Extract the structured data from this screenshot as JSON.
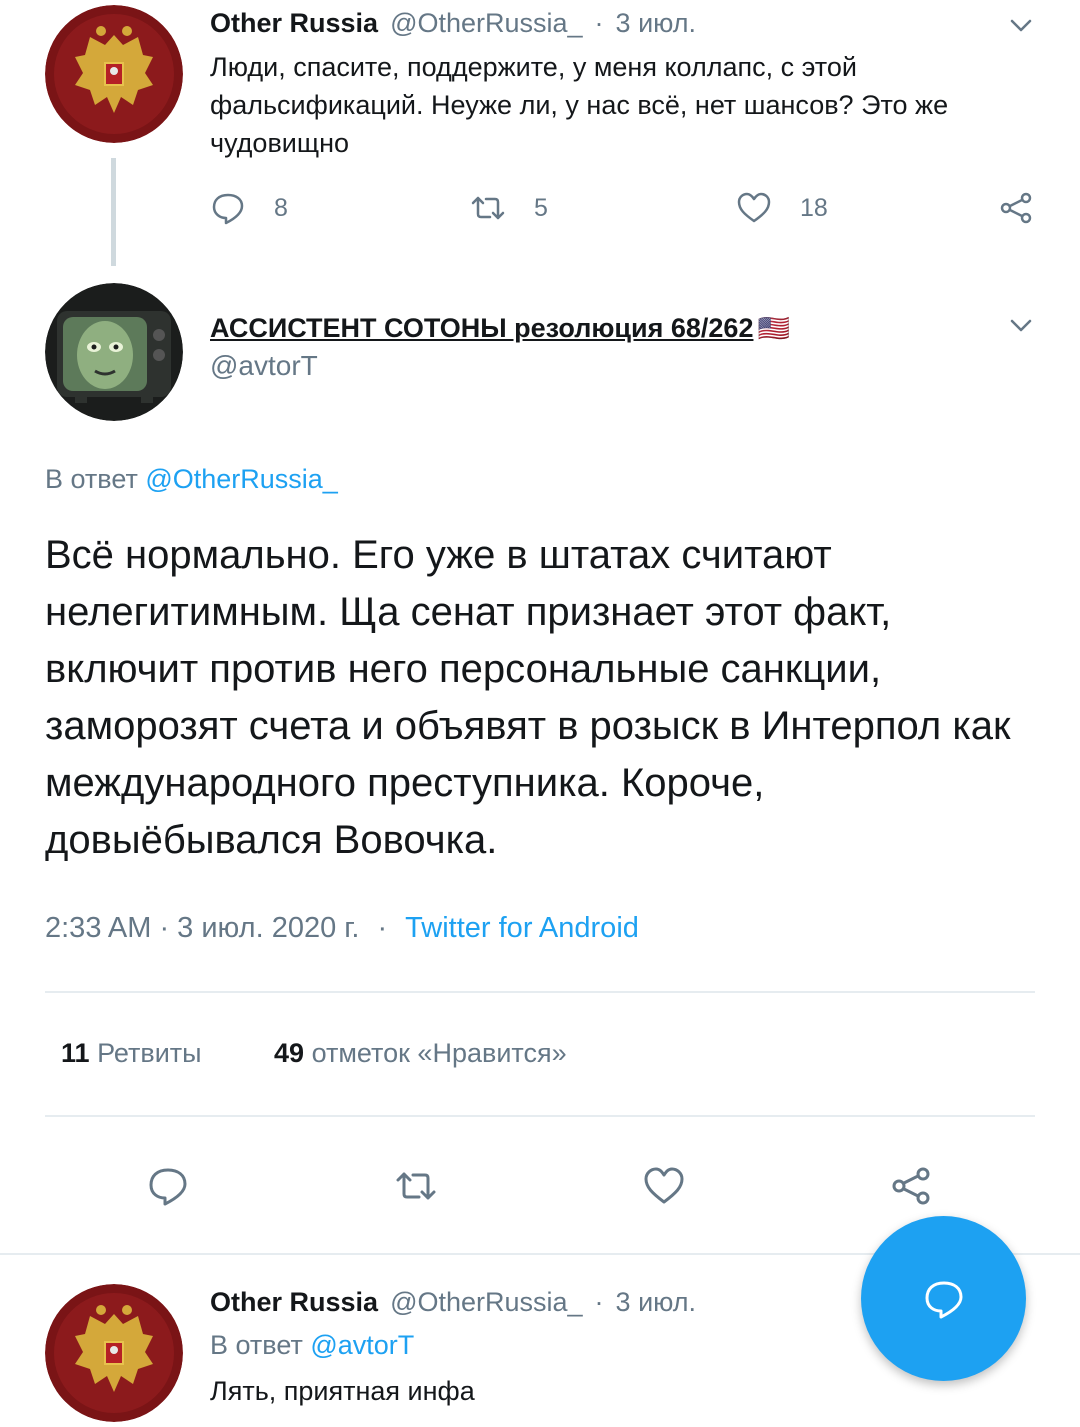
{
  "parent_tweet": {
    "name": "Other Russia",
    "handle": "@OtherRussia_",
    "separator": "·",
    "date": "3 июл.",
    "text": "Люди, спасите, поддержите, у меня коллапс, с этой фальсификаций. Неуже ли, у нас всё, нет шансов? Это же чудовищно",
    "replies": "8",
    "retweets": "5",
    "likes": "18"
  },
  "main_tweet": {
    "name": "АССИСТЕНТ СОТОНЫ резолюция 68/262",
    "flag": "🇺🇸",
    "handle": "@avtorT",
    "reply_prefix": "В ответ",
    "reply_handle": "@OtherRussia_",
    "text": "Всё нормально. Его уже в штатах считают нелегитимным. Ща  сенат признает этот факт, включит против него персональные санкции, заморозят счета и объявят в розыск в Интерпол как международного преступника. Короче, довыёбывался Вовочка.",
    "time": "2:33 AM · 3 июл. 2020 г.",
    "source_sep": "·",
    "source": "Twitter for Android",
    "retweet_count": "11",
    "retweet_label": "Ретвиты",
    "like_count": "49",
    "like_label": "отметок «Нравится»"
  },
  "reply_tweet": {
    "name": "Other Russia",
    "handle": "@OtherRussia_",
    "separator": "·",
    "date": "3 июл.",
    "reply_prefix": "В ответ",
    "reply_handle": "@avtorT",
    "text": "Лять, приятная инфа"
  },
  "colors": {
    "accent": "#1da1f2",
    "secondary_text": "#657786",
    "divider": "#e6ecf0"
  },
  "icons": [
    "reply-icon",
    "retweet-icon",
    "like-icon",
    "share-icon",
    "chevron-down-icon",
    "compose-reply-icon"
  ]
}
